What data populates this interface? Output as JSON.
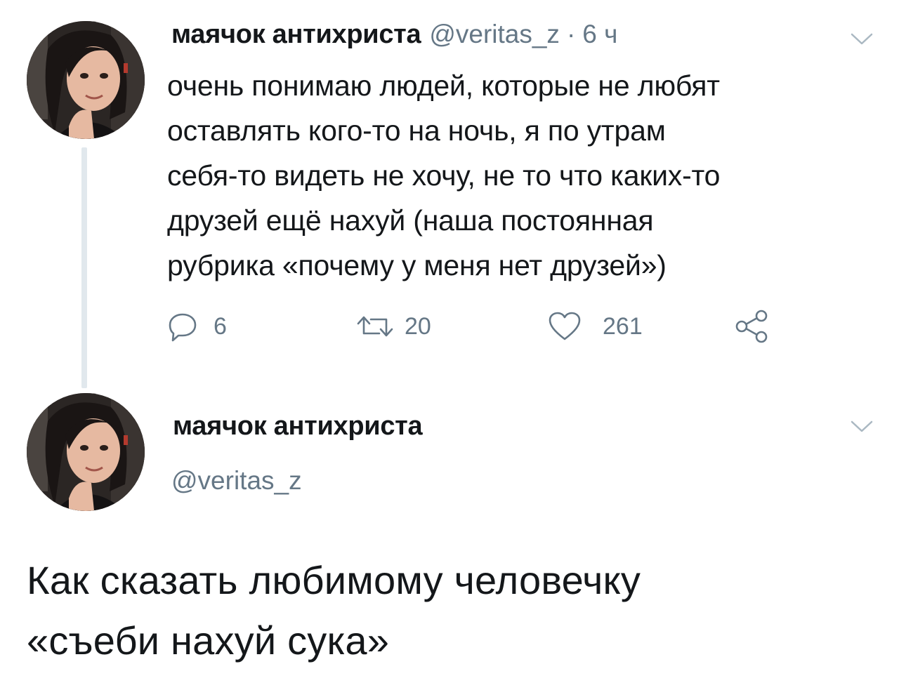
{
  "tweet1": {
    "avatar_icon": "avatar-photo-icon",
    "display_name": "маячок антихриста",
    "handle": "@veritas_z",
    "separator": "·",
    "time": "6 ч",
    "menu_icon": "chevron-down-icon",
    "text": "очень понимаю людей, которые не любят\nоставлять кого-то на ночь, я по утрам\nсебя-то видеть не хочу, не то что каких-то\nдрузей ещё нахуй (наша постоянная\nрубрика «почему у меня нет друзей»)",
    "actions": {
      "reply": {
        "icon": "reply-icon",
        "count": "6"
      },
      "retweet": {
        "icon": "retweet-icon",
        "count": "20"
      },
      "like": {
        "icon": "heart-icon",
        "count": "261"
      },
      "share": {
        "icon": "share-icon"
      }
    }
  },
  "tweet2": {
    "avatar_icon": "avatar-photo-icon",
    "display_name": "маячок антихриста",
    "handle": "@veritas_z",
    "menu_icon": "chevron-down-icon"
  },
  "caption": "Как сказать любимому человечку\n«съеби нахуй сука»",
  "colors": {
    "text": "#14171a",
    "secondary": "#657786",
    "thread_line": "#e1e8ed"
  }
}
